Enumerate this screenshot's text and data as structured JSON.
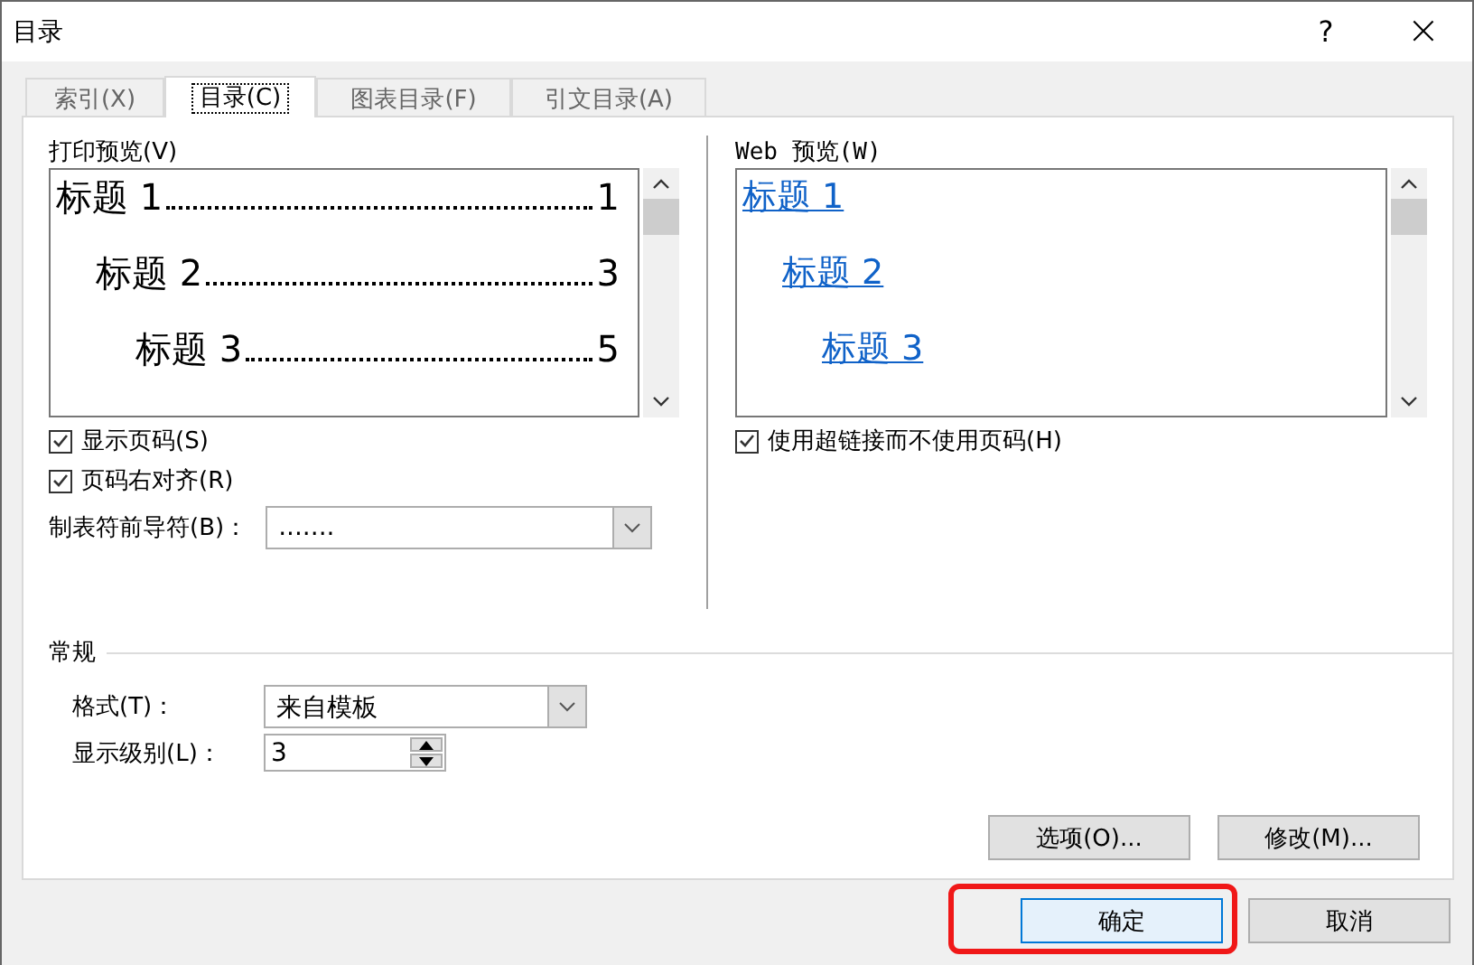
{
  "window": {
    "title": "目录",
    "help": "?",
    "close": "×"
  },
  "tabs": [
    {
      "label": "索引(X)",
      "selected": false
    },
    {
      "label": "目录(C)",
      "selected": true
    },
    {
      "label": "图表目录(F)",
      "selected": false
    },
    {
      "label": "引文目录(A)",
      "selected": false
    }
  ],
  "print_preview": {
    "label": "打印预览(V)",
    "entries": [
      {
        "text": "标题 1",
        "page": "1",
        "children": [
          {
            "text": "标题 2",
            "page": "3",
            "children": [
              {
                "text": "标题 3",
                "page": "5"
              }
            ]
          }
        ]
      }
    ]
  },
  "print_options": [
    {
      "label": "显示页码(S)",
      "checked": true
    },
    {
      "label": "页码右对齐(R)",
      "checked": true
    }
  ],
  "tab_leader": {
    "label": "制表符前导符(B)：",
    "value": "......."
  },
  "web_preview": {
    "label": "Web 预览(W)",
    "entries": [
      {
        "text": "标题 1",
        "children": [
          {
            "text": "标题 2",
            "children": [
              {
                "text": "标题 3"
              }
            ]
          }
        ]
      }
    ]
  },
  "web_options": [
    {
      "label": "使用超链接而不使用页码(H)",
      "checked": true
    }
  ],
  "general": {
    "title": "常规",
    "format": {
      "label": "格式(T)：",
      "value": "来自模板"
    },
    "levels": {
      "label": "显示级别(L)：",
      "value": "3"
    }
  },
  "panel_buttons": [
    "选项(O)...",
    "修改(M)..."
  ],
  "footer_buttons": [
    {
      "label": "确定",
      "default": true,
      "highlighted": true
    },
    {
      "label": "取消",
      "default": false,
      "highlighted": false
    }
  ]
}
